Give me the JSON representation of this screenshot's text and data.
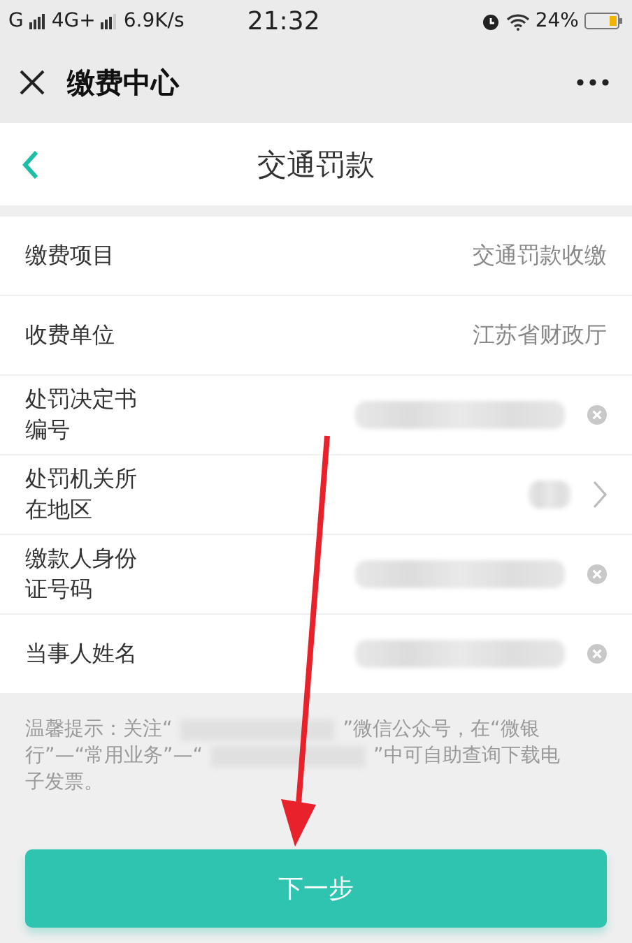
{
  "status_bar": {
    "signal_1": "G",
    "signal_2": "4G+",
    "speed": "6.9K/s",
    "time": "21:32",
    "battery": "24%"
  },
  "title_bar": {
    "title": "缴费中心"
  },
  "header": {
    "title": "交通罚款"
  },
  "rows": [
    {
      "kind": "text",
      "label": "缴费项目",
      "value": "交通罚款收缴"
    },
    {
      "kind": "text",
      "label": "收费单位",
      "value": "江苏省财政厅"
    },
    {
      "kind": "input",
      "label": "处罚决定书编号"
    },
    {
      "kind": "select",
      "label": "处罚机关所在地区"
    },
    {
      "kind": "input",
      "label": "缴款人身份证号码"
    },
    {
      "kind": "input",
      "label": "当事人姓名"
    }
  ],
  "hint_lines": [
    [
      {
        "kind": "text",
        "text": "温馨提示：关注“"
      },
      {
        "kind": "blur"
      },
      {
        "kind": "text",
        "text": "”微信公众号，在“微银"
      }
    ],
    [
      {
        "kind": "text",
        "text": "行”—“常用业务”—“"
      },
      {
        "kind": "blur"
      },
      {
        "kind": "text",
        "text": "”中可自助查询下载电"
      }
    ],
    [
      {
        "kind": "text",
        "text": "子发票。"
      }
    ]
  ],
  "button": {
    "label": "下一步"
  }
}
